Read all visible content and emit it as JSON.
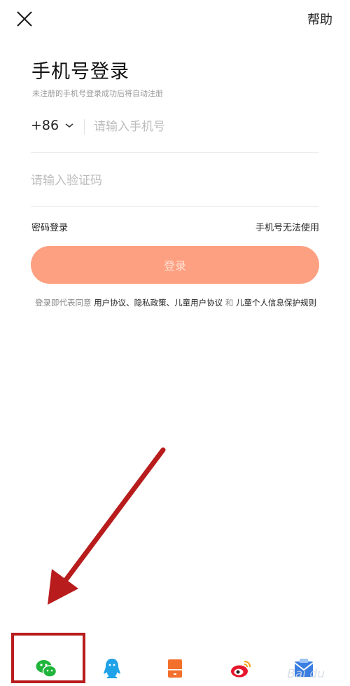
{
  "header": {
    "help_label": "帮助"
  },
  "title": "手机号登录",
  "subtitle": "未注册的手机号登录成功后将自动注册",
  "phone": {
    "country_code": "+86",
    "placeholder": "请输入手机号",
    "value": ""
  },
  "code": {
    "placeholder": "请输入验证码",
    "value": ""
  },
  "links": {
    "password_login": "密码登录",
    "phone_unavailable": "手机号无法使用"
  },
  "login_button": {
    "label": "登录",
    "color": "#fda081"
  },
  "agreement": {
    "prefix": "登录即代表同意",
    "user_agreement": "用户协议",
    "sep1": "、",
    "privacy_policy": "隐私政策",
    "sep2": "、",
    "children_agreement": "儿童用户协议",
    "and": " 和 ",
    "children_privacy": "儿童个人信息保护规则"
  },
  "social_icons": [
    "wechat-icon",
    "qq-icon",
    "phone-icon",
    "weibo-icon",
    "mail-icon"
  ],
  "watermark": "Bai du"
}
